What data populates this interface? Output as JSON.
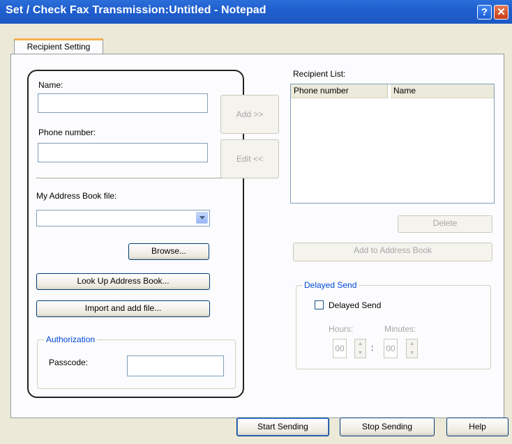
{
  "window": {
    "title": "Set / Check Fax Transmission:Untitled - Notepad",
    "help_glyph": "?",
    "close_glyph": "✕"
  },
  "tabs": [
    {
      "label": "Recipient Setting"
    }
  ],
  "form": {
    "name_label": "Name:",
    "name_value": "",
    "phone_label": "Phone number:",
    "phone_value": "",
    "address_book_label": "My Address Book file:",
    "address_book_value": "",
    "browse_label": "Browse...",
    "lookup_label": "Look Up Address Book...",
    "import_label": "Import and add file...",
    "authorization_legend": "Authorization",
    "passcode_label": "Passcode:",
    "passcode_value": ""
  },
  "middle": {
    "add_label": "Add >>",
    "edit_label": "Edit <<"
  },
  "recipients": {
    "list_label": "Recipient List:",
    "columns": [
      "Phone number",
      "Name"
    ],
    "rows": [],
    "delete_label": "Delete",
    "add_to_book_label": "Add to Address Book"
  },
  "delayed": {
    "legend": "Delayed Send",
    "checkbox_label": "Delayed Send",
    "hours_label": "Hours:",
    "minutes_label": "Minutes:",
    "hours_value": "00",
    "minutes_value": "00",
    "separator": ":"
  },
  "footer": {
    "start_label": "Start Sending",
    "stop_label": "Stop Sending",
    "help_label": "Help"
  }
}
